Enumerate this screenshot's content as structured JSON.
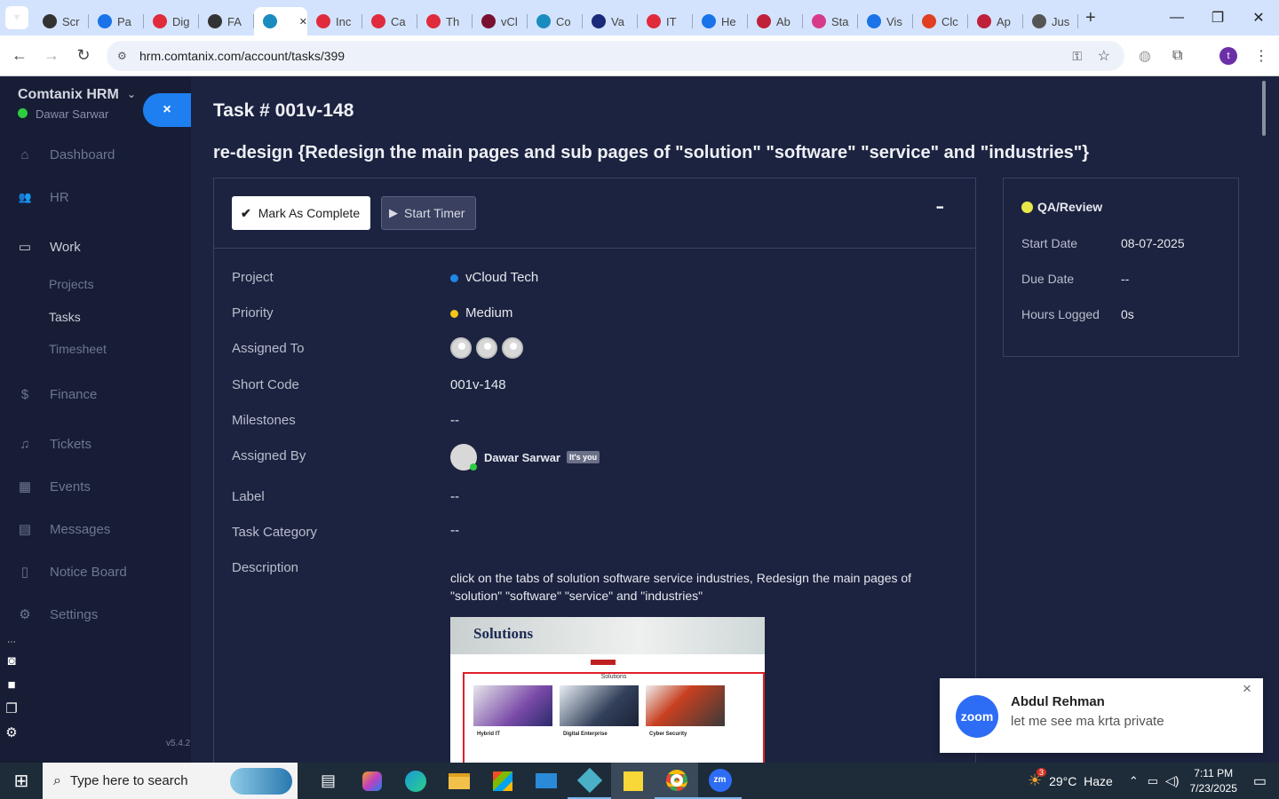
{
  "browser": {
    "tabs": [
      {
        "label": "Scr",
        "color": "#333"
      },
      {
        "label": "Pa",
        "color": "#1a73e8"
      },
      {
        "label": "Dig",
        "color": "#e02b3c"
      },
      {
        "label": "FA",
        "color": "#333"
      },
      {
        "label": "",
        "color": "#1a8cbf",
        "active": true
      },
      {
        "label": "Inc",
        "color": "#e02b3c"
      },
      {
        "label": "Ca",
        "color": "#e02b3c"
      },
      {
        "label": "Th",
        "color": "#e02b3c"
      },
      {
        "label": "vCl",
        "color": "#7a1030"
      },
      {
        "label": "Co",
        "color": "#1a8cbf"
      },
      {
        "label": "Va",
        "color": "#1a2a7a"
      },
      {
        "label": "IT",
        "color": "#e02b3c"
      },
      {
        "label": "He",
        "color": "#1a73e8"
      },
      {
        "label": "Ab",
        "color": "#c0203a"
      },
      {
        "label": "Sta",
        "color": "#d83a8a"
      },
      {
        "label": "Vis",
        "color": "#1a73e8"
      },
      {
        "label": "Clc",
        "color": "#e04020"
      },
      {
        "label": "Ap",
        "color": "#c0203a"
      },
      {
        "label": "Jus",
        "color": "#555"
      }
    ],
    "url": "hrm.comtanix.com/account/tasks/399",
    "profile_initial": "t"
  },
  "sidebar": {
    "company": "Comtanix HRM",
    "user": "Dawar Sarwar",
    "close_icon": "×",
    "items": [
      {
        "label": "Dashboard",
        "icon": "⌂"
      },
      {
        "label": "HR",
        "icon": "👥"
      },
      {
        "label": "Work",
        "icon": "▭"
      },
      {
        "label": "Finance",
        "icon": "$"
      },
      {
        "label": "Tickets",
        "icon": "♫"
      },
      {
        "label": "Events",
        "icon": "▦"
      },
      {
        "label": "Messages",
        "icon": "▤"
      },
      {
        "label": "Notice Board",
        "icon": "▯"
      },
      {
        "label": "Settings",
        "icon": "⚙"
      }
    ],
    "work_subitems": [
      "Projects",
      "Tasks",
      "Timesheet"
    ],
    "version": "v5.4.2"
  },
  "task": {
    "number": "Task # 001v-148",
    "title": "re-design {Redesign the main pages and sub pages of \"solution\" \"software\" \"service\" and \"industries\"}",
    "mark_complete": "Mark As Complete",
    "start_timer": "Start Timer",
    "more": "•••",
    "fields": {
      "project_label": "Project",
      "project_value": "vCloud Tech",
      "priority_label": "Priority",
      "priority_value": "Medium",
      "assigned_to_label": "Assigned To",
      "short_code_label": "Short Code",
      "short_code_value": "001v-148",
      "milestones_label": "Milestones",
      "milestones_value": "--",
      "assigned_by_label": "Assigned By",
      "assigned_by_value": "Dawar Sarwar",
      "its_you": "It's you",
      "label_label": "Label",
      "label_value": "--",
      "category_label": "Task Category",
      "category_value": "--",
      "description_label": "Description",
      "description_value": "click on the tabs of solution software service industries, Redesign the main pages of \"solution\" \"software\" \"service\" and \"industries\""
    },
    "preview": {
      "heading": "Solutions",
      "subheading": "Solutions",
      "cards": [
        "Hybrid IT",
        "Digital Enterprise",
        "Cyber Security"
      ]
    }
  },
  "status_panel": {
    "status": "QA/Review",
    "start_date_label": "Start Date",
    "start_date_value": "08-07-2025",
    "due_date_label": "Due Date",
    "due_date_value": "--",
    "hours_label": "Hours Logged",
    "hours_value": "0s"
  },
  "zoom_toast": {
    "app": "zoom",
    "name": "Abdul Rehman",
    "message": "let me see ma krta private",
    "close": "×"
  },
  "taskbar": {
    "search_placeholder": "Type here to search",
    "weather": "29°C  Haze",
    "weather_badge": "3",
    "time": "7:11 PM",
    "date": "7/23/2025"
  },
  "colors": {
    "priority_dot": "#f5c518",
    "project_dot": "#1e88e5",
    "status_dot": "#e8e84a",
    "online_dot": "#2ecc40"
  }
}
